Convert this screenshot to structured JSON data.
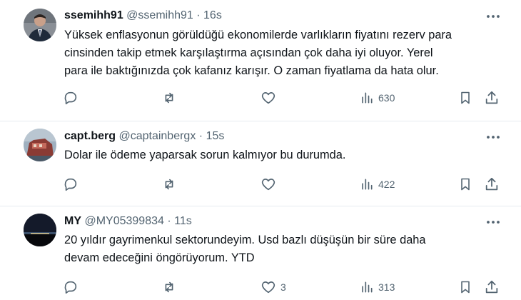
{
  "tweets": [
    {
      "display_name": "ssemihh91",
      "handle": "@ssemihh91",
      "separator": "·",
      "time": "16s",
      "lines": [
        "Yüksek enflasyonun görüldüğü ekonomilerde varlıkların fiyatını rezerv para",
        "cinsinden takip etmek karşılaştırma açısından çok daha iyi oluyor. Yerel",
        "para ile baktığınızda çok kafanız karışır. O zaman fiyatlama da hata olur."
      ],
      "views": "630",
      "likes": ""
    },
    {
      "display_name": "capt.berg",
      "handle": "@captainbergx",
      "separator": "·",
      "time": "15s",
      "lines": [
        "Dolar ile ödeme yaparsak sorun kalmıyor bu durumda."
      ],
      "views": "422",
      "likes": ""
    },
    {
      "display_name": "MY",
      "handle": "@MY05399834",
      "separator": "·",
      "time": "11s",
      "lines": [
        "20 yıldır gayrimenkul sektorundeyim. Usd bazlı düşüşün bir süre daha",
        "devam edeceğini öngörüyorum. YTD"
      ],
      "views": "313",
      "likes": "3"
    }
  ],
  "colors": {
    "text": "#0f1419",
    "secondary": "#536471",
    "divider": "#e6ecf0"
  },
  "icons": [
    "more-icon",
    "reply-icon",
    "retweet-icon",
    "like-icon",
    "views-icon",
    "bookmark-icon",
    "share-icon"
  ]
}
